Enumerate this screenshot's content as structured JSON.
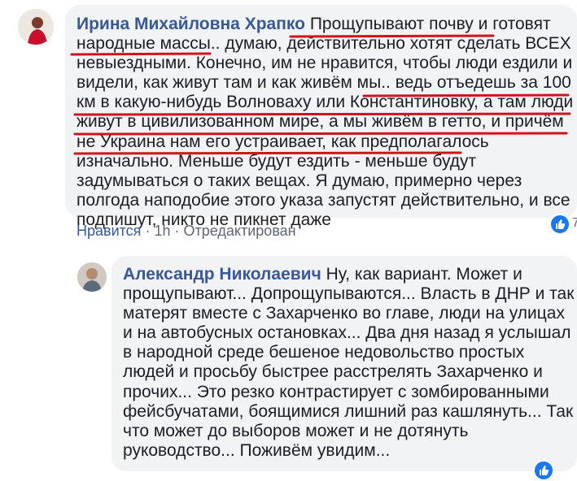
{
  "comment1": {
    "author": "Ирина Михайловна Храпко",
    "text": "Прощупывают почву и готовят народные массы.. думаю, действительно хотят сделать ВСЕХ невыездными. Конечно, им не нравится, чтобы люди ездили и видели, как живут там и как живём мы.. ведь отъедешь за 100 км в какую-нибудь Волноваху или Константиновку, а там люди живут в цивилизованном мире, а мы живём в гетто, и причём не Украина нам его устраивает, как предполагалось изначально. Меньше будут ездить - меньше будут задумываться о таких вещах. Я думаю, примерно через полгода наподобие этого указа запустят действительно, и все подпишут, никто не пикнет даже",
    "like_label": "Нравится",
    "time": "1h",
    "edited_label": "Отредактирован",
    "separator": "·",
    "reaction_count": "7"
  },
  "comment2": {
    "author": "Александр Николаевич",
    "text": "Ну, как вариант. Может и прощупывают... Допрощупываются... Власть в ДНР и так матерят вместе с Захарченко во главе, люди на улицах и на автобусных остановках... Два дня назад я услышал в народной среде бешеное недовольство простых людей и просьбу быстрее расстрелять Захарченко и прочих... Это резко контрастирует с зомбированными фейсбучатами, боящимися лишний раз кашлянуть... Так что может до выборов может и не дотянуть руководство... Поживём увидим..."
  },
  "colors": {
    "author": "#385898",
    "bubble": "#f2f3f5",
    "underline": "#d0141b",
    "meta": "#606770",
    "reaction": "#1877f2"
  },
  "icons": {
    "reaction": "like-icon"
  }
}
